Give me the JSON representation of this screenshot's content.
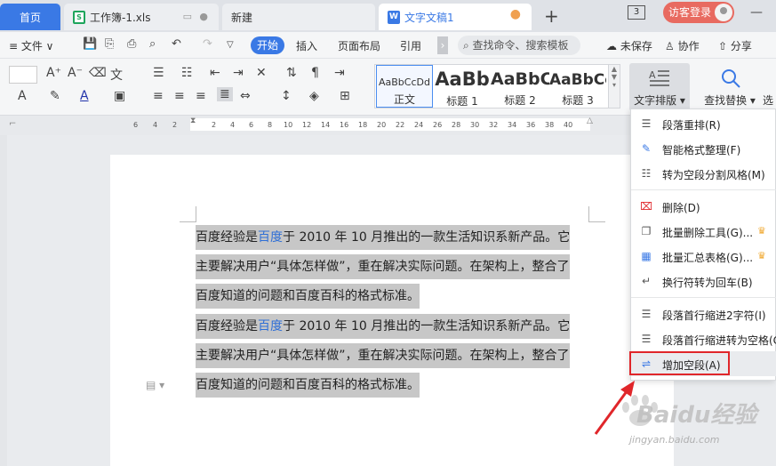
{
  "tabs": {
    "home": "首页",
    "xls": "工作簿-1.xls",
    "new": "新建",
    "doc": "文字文稿1",
    "count": "3",
    "login": "访客登录"
  },
  "menu": {
    "file": "≡ 文件 ∨",
    "start": "开始",
    "insert": "插入",
    "layout": "页面布局",
    "reference": "引用",
    "more": "›",
    "search": "查找命令、搜索模板",
    "unsaved": "未保存",
    "collab": "协作",
    "share": "分享"
  },
  "styles": [
    {
      "preview": "AaBbCcDd",
      "name": "正文"
    },
    {
      "preview": "AaBb",
      "name": "标题 1"
    },
    {
      "preview": "AaBbC",
      "name": "标题 2"
    },
    {
      "preview": "AaBbCc",
      "name": "标题 3"
    }
  ],
  "ribbon": {
    "text_layout": "文字排版",
    "find_replace": "查找替换",
    "select": "选"
  },
  "ruler": [
    "6",
    "4",
    "2",
    "2",
    "4",
    "6",
    "8",
    "10",
    "12",
    "14",
    "16",
    "18",
    "20",
    "22",
    "24",
    "26",
    "28",
    "30",
    "32",
    "34",
    "36",
    "38",
    "40"
  ],
  "document": {
    "para1": {
      "line1_a": "百度经验是",
      "line1_link": "百度",
      "line1_b": "于 2010 年 10 月推出的一款生活知识系新产品。它",
      "line2": "主要解决用户“具体怎样做”，重在解决实际问题。在架构上，整合了",
      "line3": "百度知道的问题和百度百科的格式标准。"
    },
    "para2": {
      "line1_a": "百度经验是",
      "line1_link": "百度",
      "line1_b": "于 2010 年 10 月推出的一款生活知识系新产品。它",
      "line2": "主要解决用户“具体怎样做”，重在解决实际问题。在架构上，整合了",
      "line3": "百度知道的问题和百度百科的格式标准。"
    }
  },
  "dropdown": [
    {
      "label": "段落重排(R)",
      "icon": "paragraph-rearrange-icon"
    },
    {
      "label": "智能格式整理(F)",
      "icon": "smart-format-icon"
    },
    {
      "label": "转为空段分割风格(M)",
      "icon": "blank-split-icon"
    },
    {
      "label": "删除(D)",
      "icon": "delete-icon"
    },
    {
      "label": "批量删除工具(G)...",
      "icon": "batch-delete-icon",
      "premium": true
    },
    {
      "label": "批量汇总表格(G)...",
      "icon": "batch-table-icon",
      "premium": true
    },
    {
      "label": "换行符转为回车(B)",
      "icon": "line-break-icon"
    },
    {
      "label": "段落首行缩进2字符(I)",
      "icon": "indent-icon"
    },
    {
      "label": "段落首行缩进转为空格(C)",
      "icon": "indent-space-icon"
    },
    {
      "label": "增加空段(A)",
      "icon": "add-blank-icon"
    }
  ],
  "watermark": {
    "text": "Baidu经验",
    "url": "jingyan.baidu.com"
  },
  "colors": {
    "accent": "#3a79e5",
    "highlight_text": "#c7c7c7",
    "annotation_red": "#e0262a"
  }
}
